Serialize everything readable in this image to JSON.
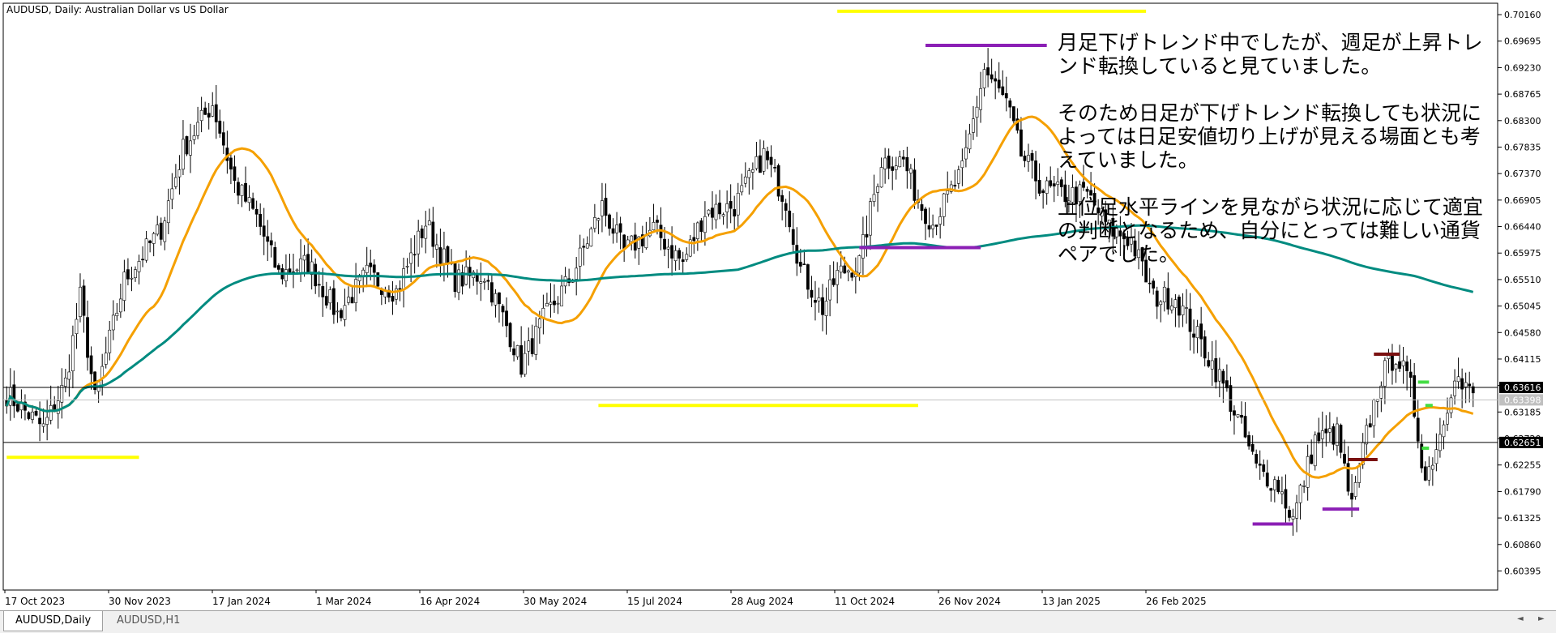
{
  "chart_data": {
    "type": "candlestick",
    "title": "AUDUSD, Daily:  Australian Dollar vs US Dollar",
    "ylim": [
      0.6006,
      0.7036
    ],
    "y_ticks": [
      "0.70160",
      "0.69695",
      "0.69230",
      "0.68765",
      "0.68300",
      "0.67835",
      "0.67370",
      "0.66905",
      "0.66440",
      "0.65975",
      "0.65510",
      "0.65045",
      "0.64580",
      "0.64115",
      "0.63650",
      "0.63185",
      "0.62720",
      "0.62255",
      "0.61790",
      "0.61325",
      "0.60860",
      "0.60395"
    ],
    "x_ticks": [
      "17 Oct 2023",
      "30 Nov 2023",
      "17 Jan 2024",
      "1 Mar 2024",
      "16 Apr 2024",
      "30 May 2024",
      "15 Jul 2024",
      "28 Aug 2024",
      "11 Oct 2024",
      "26 Nov 2024",
      "13 Jan 2025",
      "26 Feb 2025"
    ],
    "bar_count": 400,
    "price_anchors": [
      [
        0,
        0.635
      ],
      [
        10,
        0.629
      ],
      [
        16,
        0.637
      ],
      [
        20,
        0.652
      ],
      [
        24,
        0.634
      ],
      [
        32,
        0.655
      ],
      [
        42,
        0.664
      ],
      [
        48,
        0.678
      ],
      [
        56,
        0.686
      ],
      [
        62,
        0.672
      ],
      [
        68,
        0.666
      ],
      [
        74,
        0.656
      ],
      [
        82,
        0.658
      ],
      [
        90,
        0.649
      ],
      [
        98,
        0.656
      ],
      [
        106,
        0.653
      ],
      [
        114,
        0.665
      ],
      [
        122,
        0.655
      ],
      [
        130,
        0.656
      ],
      [
        136,
        0.647
      ],
      [
        140,
        0.64
      ],
      [
        146,
        0.648
      ],
      [
        154,
        0.656
      ],
      [
        162,
        0.668
      ],
      [
        168,
        0.66
      ],
      [
        176,
        0.664
      ],
      [
        184,
        0.658
      ],
      [
        190,
        0.667
      ],
      [
        198,
        0.668
      ],
      [
        206,
        0.677
      ],
      [
        212,
        0.669
      ],
      [
        216,
        0.657
      ],
      [
        222,
        0.65
      ],
      [
        226,
        0.656
      ],
      [
        232,
        0.658
      ],
      [
        238,
        0.676
      ],
      [
        244,
        0.676
      ],
      [
        248,
        0.669
      ],
      [
        252,
        0.665
      ],
      [
        260,
        0.674
      ],
      [
        266,
        0.692
      ],
      [
        272,
        0.686
      ],
      [
        276,
        0.677
      ],
      [
        282,
        0.671
      ],
      [
        288,
        0.67
      ],
      [
        294,
        0.67
      ],
      [
        300,
        0.664
      ],
      [
        306,
        0.662
      ],
      [
        312,
        0.652
      ],
      [
        318,
        0.652
      ],
      [
        324,
        0.645
      ],
      [
        330,
        0.638
      ],
      [
        336,
        0.629
      ],
      [
        340,
        0.622
      ],
      [
        346,
        0.619
      ],
      [
        350,
        0.613
      ],
      [
        356,
        0.627
      ],
      [
        362,
        0.628
      ],
      [
        366,
        0.615
      ],
      [
        370,
        0.628
      ],
      [
        374,
        0.638
      ],
      [
        378,
        0.642
      ],
      [
        382,
        0.636
      ],
      [
        386,
        0.62
      ],
      [
        390,
        0.628
      ],
      [
        394,
        0.639
      ],
      [
        396,
        0.636
      ],
      [
        399,
        0.6352
      ]
    ],
    "indicators": [
      {
        "color": "#f5a000",
        "period": 20,
        "kind": "SMA"
      },
      {
        "color": "#008b80",
        "period": 200,
        "kind": "SMA"
      }
    ],
    "horizontal_lines": [
      {
        "price": 0.63616,
        "label": "0.63616",
        "label_bg": "#000000",
        "label_fg": "#ffffff",
        "line_color": "#000000"
      },
      {
        "price": 0.63398,
        "label": "0.63398",
        "label_bg": "#c0c0c0",
        "label_fg": "#ffffff",
        "line_color": "#c0c0c0"
      },
      {
        "price": 0.62651,
        "label": "0.62651",
        "label_bg": "#000000",
        "label_fg": "#ffffff",
        "line_color": "#000000"
      }
    ],
    "segments": [
      {
        "bar_from": 0,
        "bar_to": 36,
        "price": 0.6239,
        "color": "#ffff00",
        "width": 4
      },
      {
        "bar_from": 161,
        "bar_to": 248,
        "price": 0.633,
        "color": "#ffff00",
        "width": 4
      },
      {
        "bar_from": 226,
        "bar_to": 310,
        "price": 0.7022,
        "color": "#ffff00",
        "width": 4
      },
      {
        "bar_from": 250,
        "bar_to": 283,
        "price": 0.6962,
        "color": "#8b1fb5",
        "width": 4
      },
      {
        "bar_from": 232,
        "bar_to": 265,
        "price": 0.6607,
        "color": "#8b1fb5",
        "width": 4
      },
      {
        "bar_from": 339,
        "bar_to": 350,
        "price": 0.6122,
        "color": "#8b1fb5",
        "width": 4
      },
      {
        "bar_from": 358,
        "bar_to": 368,
        "price": 0.6148,
        "color": "#8b1fb5",
        "width": 4
      },
      {
        "bar_from": 365,
        "bar_to": 373,
        "price": 0.6235,
        "color": "#7a1010",
        "width": 4
      },
      {
        "bar_from": 372,
        "bar_to": 379,
        "price": 0.642,
        "color": "#7a1010",
        "width": 4
      },
      {
        "bar_from": 384,
        "bar_to": 387,
        "price": 0.6371,
        "color": "#44dd44",
        "width": 4
      },
      {
        "bar_from": 386,
        "bar_to": 388,
        "price": 0.633,
        "color": "#44dd44",
        "width": 4
      },
      {
        "bar_from": 385,
        "bar_to": 387,
        "price": 0.6255,
        "color": "#44dd44",
        "width": 4
      }
    ]
  },
  "annotation": {
    "paragraphs": [
      "月足下げトレンド中でしたが、週足が上昇トレンド転換していると見ていました。",
      "そのため日足が下げトレンド転換しても状況によっては日足安値切り上げが見える場面とも考えていました。",
      "上位足水平ラインを見ながら状況に応じて適宜の判断となるため、自分にとっては難しい通貨ペアでした。"
    ]
  },
  "tabs": [
    {
      "label": "AUDUSD,Daily",
      "active": true
    },
    {
      "label": "AUDUSD,H1",
      "active": false
    }
  ],
  "tab_scroll": {
    "left": "◄",
    "right": "►"
  }
}
